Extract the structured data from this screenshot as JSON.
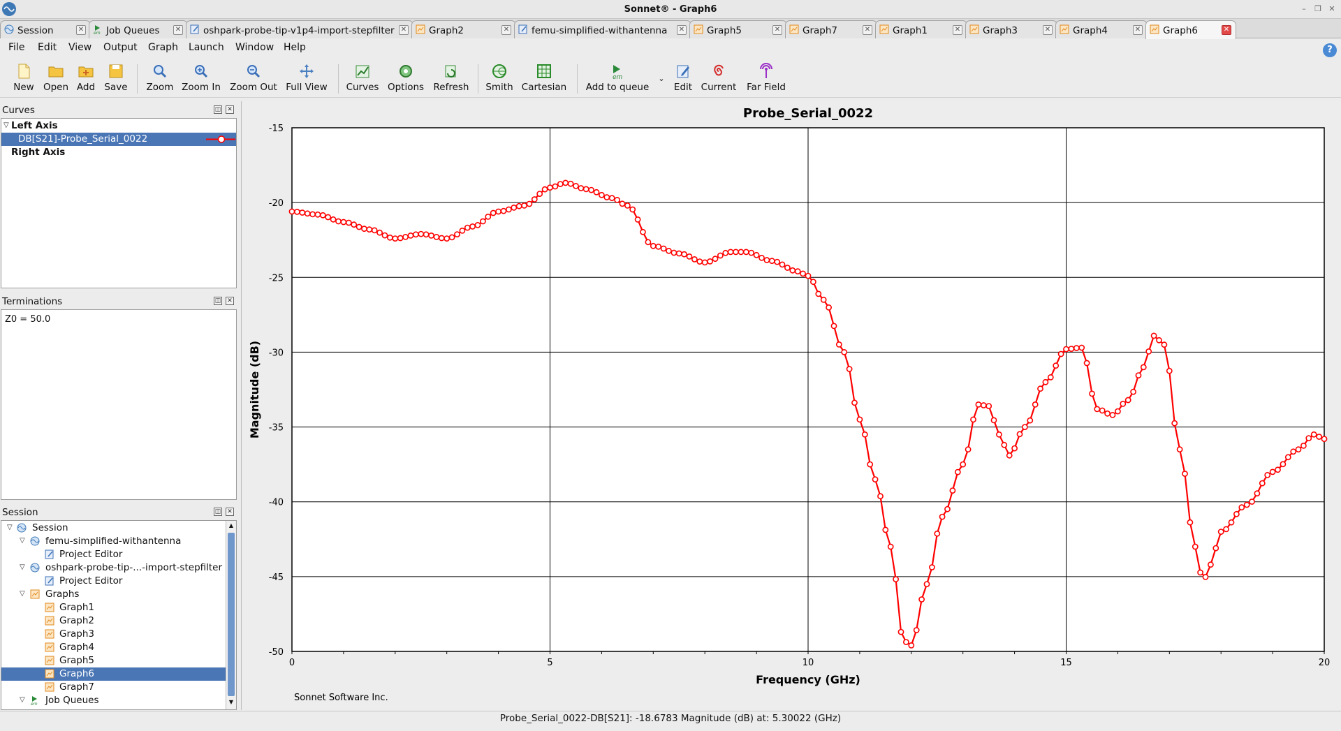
{
  "window": {
    "title": "Sonnet® - Graph6"
  },
  "tabs": [
    {
      "label": "Session",
      "icon": "sonnet-session-icon"
    },
    {
      "label": "Job Queues",
      "icon": "em-queue-icon"
    },
    {
      "label": "oshpark-probe-tip-v1p4-import-stepfilter",
      "icon": "project-editor-icon"
    },
    {
      "label": "Graph2",
      "icon": "graph-icon"
    },
    {
      "label": "femu-simplified-withantenna",
      "icon": "project-editor-icon"
    },
    {
      "label": "Graph5",
      "icon": "graph-icon"
    },
    {
      "label": "Graph7",
      "icon": "graph-icon"
    },
    {
      "label": "Graph1",
      "icon": "graph-icon"
    },
    {
      "label": "Graph3",
      "icon": "graph-icon"
    },
    {
      "label": "Graph4",
      "icon": "graph-icon"
    },
    {
      "label": "Graph6",
      "icon": "graph-icon",
      "active": true
    }
  ],
  "menu": {
    "file": "File",
    "edit": "Edit",
    "view": "View",
    "output": "Output",
    "graph": "Graph",
    "launch": "Launch",
    "window": "Window",
    "help": "Help"
  },
  "toolbar": {
    "new": "New",
    "open": "Open",
    "add": "Add",
    "save": "Save",
    "zoom": "Zoom",
    "zoom_in": "Zoom In",
    "zoom_out": "Zoom Out",
    "full_view": "Full View",
    "curves": "Curves",
    "options": "Options",
    "refresh": "Refresh",
    "smith": "Smith",
    "cartesian": "Cartesian",
    "add_to_queue": "Add to queue",
    "edit": "Edit",
    "current": "Current",
    "far_field": "Far Field"
  },
  "curves_panel": {
    "title": "Curves",
    "left_axis": "Left Axis",
    "curve": "DB[S21]-Probe_Serial_0022",
    "right_axis": "Right Axis"
  },
  "terminations_panel": {
    "title": "Terminations",
    "z0": "Z0 = 50.0"
  },
  "session_panel": {
    "title": "Session",
    "session": "Session",
    "project1": "femu-simplified-withantenna",
    "project1_editor": "Project Editor",
    "project2": "oshpark-probe-tip-...-import-stepfilter",
    "project2_editor": "Project Editor",
    "graphs": "Graphs",
    "graph_items": [
      "Graph1",
      "Graph2",
      "Graph3",
      "Graph4",
      "Graph5",
      "Graph6",
      "Graph7"
    ],
    "job_queues": "Job Queues"
  },
  "graph": {
    "footer": "Sonnet Software Inc."
  },
  "status": {
    "text": "Probe_Serial_0022-DB[S21]: -18.6783 Magnitude (dB) at: 5.30022 (GHz)"
  },
  "colors": {
    "curve": "#ff0000",
    "selection": "#4a76b5",
    "active_tab_close": "#e24a4a"
  },
  "chart_data": {
    "type": "line",
    "title": "Probe_Serial_0022",
    "xlabel": "Frequency (GHz)",
    "ylabel": "Magnitude (dB)",
    "xlim": [
      0,
      20
    ],
    "ylim": [
      -50,
      -15
    ],
    "xticks": [
      0,
      5,
      10,
      15,
      20
    ],
    "yticks": [
      -15,
      -20,
      -25,
      -30,
      -35,
      -40,
      -45,
      -50
    ],
    "grid": true,
    "series": [
      {
        "name": "DB[S21]-Probe_Serial_0022",
        "color": "#ff0000",
        "x": [
          0,
          0.5,
          1,
          1.5,
          2,
          2.5,
          3,
          3.5,
          4,
          4.5,
          5,
          5.3,
          5.7,
          6.2,
          6.5,
          7,
          7.5,
          8,
          8.5,
          8.8,
          9.3,
          9.8,
          10,
          10.3,
          10.7,
          11,
          11.3,
          11.6,
          11.85,
          12,
          12.3,
          12.6,
          13,
          13.3,
          13.5,
          13.7,
          13.9,
          14.2,
          14.6,
          15,
          15.3,
          15.6,
          15.9,
          16.2,
          16.5,
          16.7,
          16.9,
          17.2,
          17.5,
          17.65,
          17.8,
          18,
          18.5,
          19,
          19.5,
          19.8,
          20
        ],
        "y": [
          -20.6,
          -20.8,
          -21.3,
          -21.8,
          -22.4,
          -22.1,
          -22.4,
          -21.6,
          -20.6,
          -20.2,
          -19.0,
          -18.68,
          -19.1,
          -19.7,
          -20.2,
          -22.9,
          -23.4,
          -24.0,
          -23.3,
          -23.3,
          -23.9,
          -24.6,
          -24.9,
          -26.5,
          -30.0,
          -34.5,
          -38.5,
          -43.0,
          -49.3,
          -49.6,
          -45.5,
          -41.0,
          -37.5,
          -33.5,
          -33.6,
          -35.5,
          -36.9,
          -35.0,
          -32.0,
          -29.8,
          -29.7,
          -33.8,
          -34.2,
          -33.2,
          -31.0,
          -28.9,
          -29.5,
          -36.5,
          -43.0,
          -45.3,
          -44.2,
          -42.0,
          -40.2,
          -38.0,
          -36.5,
          -35.5,
          -35.8
        ]
      }
    ]
  }
}
